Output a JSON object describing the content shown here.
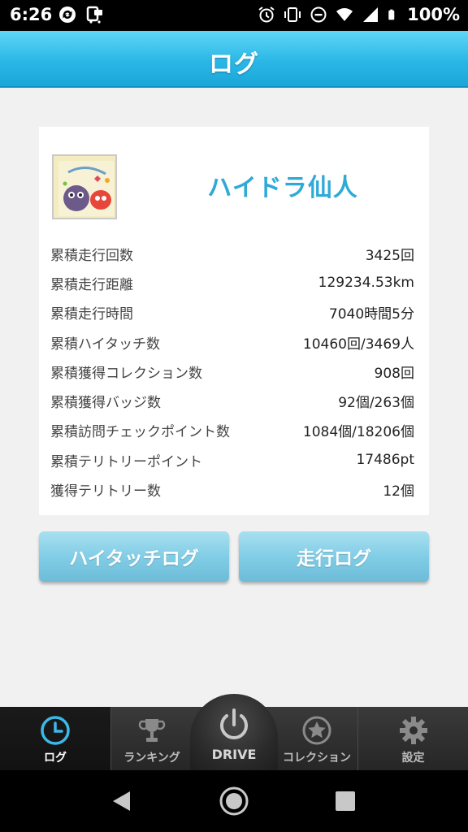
{
  "status_bar": {
    "time": "6:26",
    "battery_text": "100%"
  },
  "header": {
    "title": "ログ"
  },
  "profile": {
    "name": "ハイドラ仙人"
  },
  "stats": [
    {
      "label": "累積走行回数",
      "value": "3425回"
    },
    {
      "label": "累積走行距離",
      "value": "129234.53km"
    },
    {
      "label": "累積走行時間",
      "value": "7040時間5分"
    },
    {
      "label": "累積ハイタッチ数",
      "value": "10460回/3469人"
    },
    {
      "label": "累積獲得コレクション数",
      "value": "908回"
    },
    {
      "label": "累積獲得バッジ数",
      "value": "92個/263個"
    },
    {
      "label": "累積訪問チェックポイント数",
      "value": "1084個/18206個"
    },
    {
      "label": "累積テリトリーポイント",
      "value": "17486pt"
    },
    {
      "label": "獲得テリトリー数",
      "value": "12個"
    }
  ],
  "buttons": {
    "hitouch_log": "ハイタッチログ",
    "run_log": "走行ログ"
  },
  "tabs": {
    "log": "ログ",
    "ranking": "ランキング",
    "drive": "DRIVE",
    "collection": "コレクション",
    "settings": "設定"
  },
  "colors": {
    "header": "#2bb7e6",
    "accent_name": "#2fa9d6",
    "button": "#82cde6",
    "active_tab_icon": "#3bb9e8"
  }
}
